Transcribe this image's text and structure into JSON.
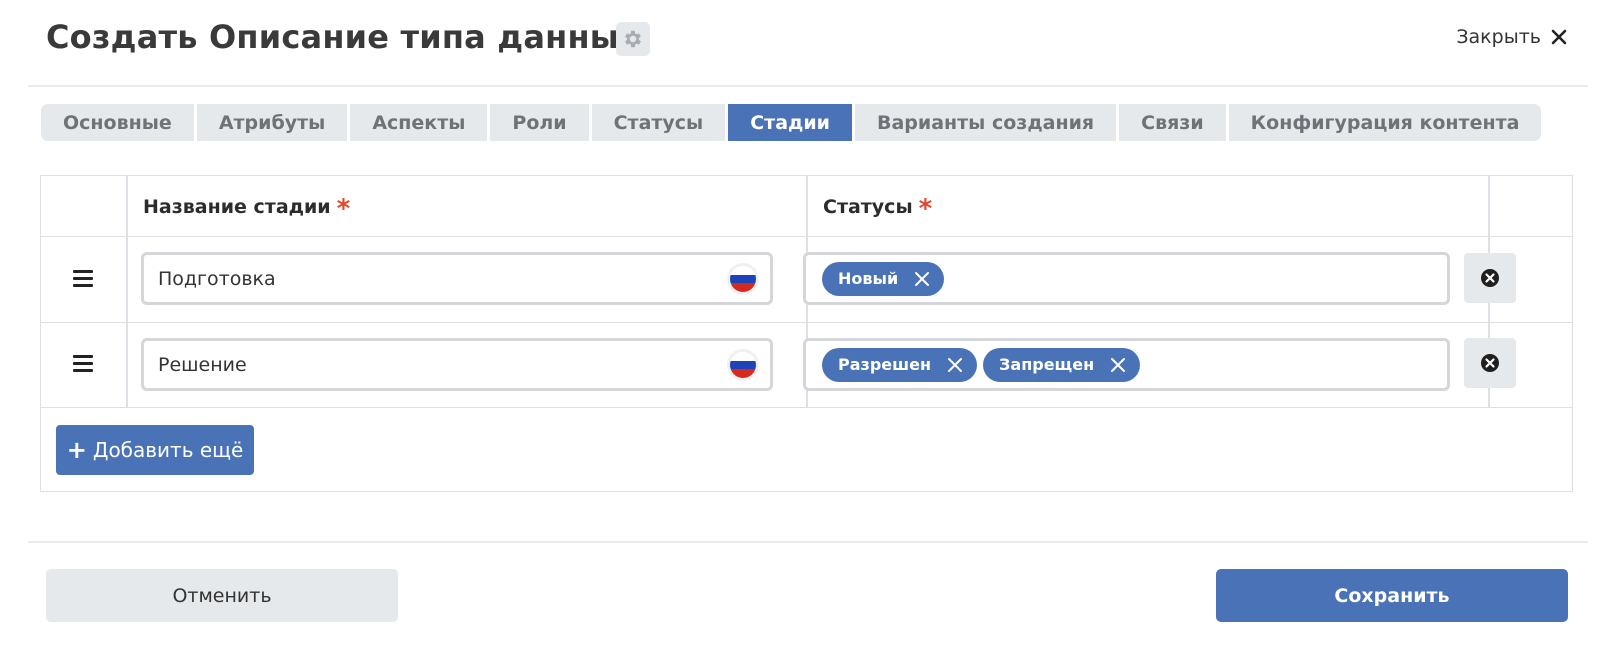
{
  "dialog": {
    "title": "Создать Описание типа данных",
    "close_label": "Закрыть",
    "settings_icon": "gear-icon",
    "close_icon": "close-x-icon"
  },
  "tabs": [
    {
      "label": "Основные",
      "active": false
    },
    {
      "label": "Атрибуты",
      "active": false
    },
    {
      "label": "Аспекты",
      "active": false
    },
    {
      "label": "Роли",
      "active": false
    },
    {
      "label": "Статусы",
      "active": false
    },
    {
      "label": "Стадии",
      "active": true
    },
    {
      "label": "Варианты создания",
      "active": false
    },
    {
      "label": "Связи",
      "active": false
    },
    {
      "label": "Конфигурация контента",
      "active": false
    }
  ],
  "table": {
    "columns": {
      "stage_name": "Название стадии",
      "statuses": "Статусы",
      "required_mark": "*"
    },
    "rows": [
      {
        "stage_name": "Подготовка",
        "statuses": [
          "Новый"
        ]
      },
      {
        "stage_name": "Решение",
        "statuses": [
          "Разрешен",
          "Запрещен"
        ]
      }
    ],
    "add_more_label": "Добавить ещё"
  },
  "footer": {
    "cancel_label": "Отменить",
    "save_label": "Сохранить"
  },
  "colors": {
    "accent": "#4a72b6",
    "tab_bg": "#e6e9ec",
    "required": "#e0492f"
  }
}
